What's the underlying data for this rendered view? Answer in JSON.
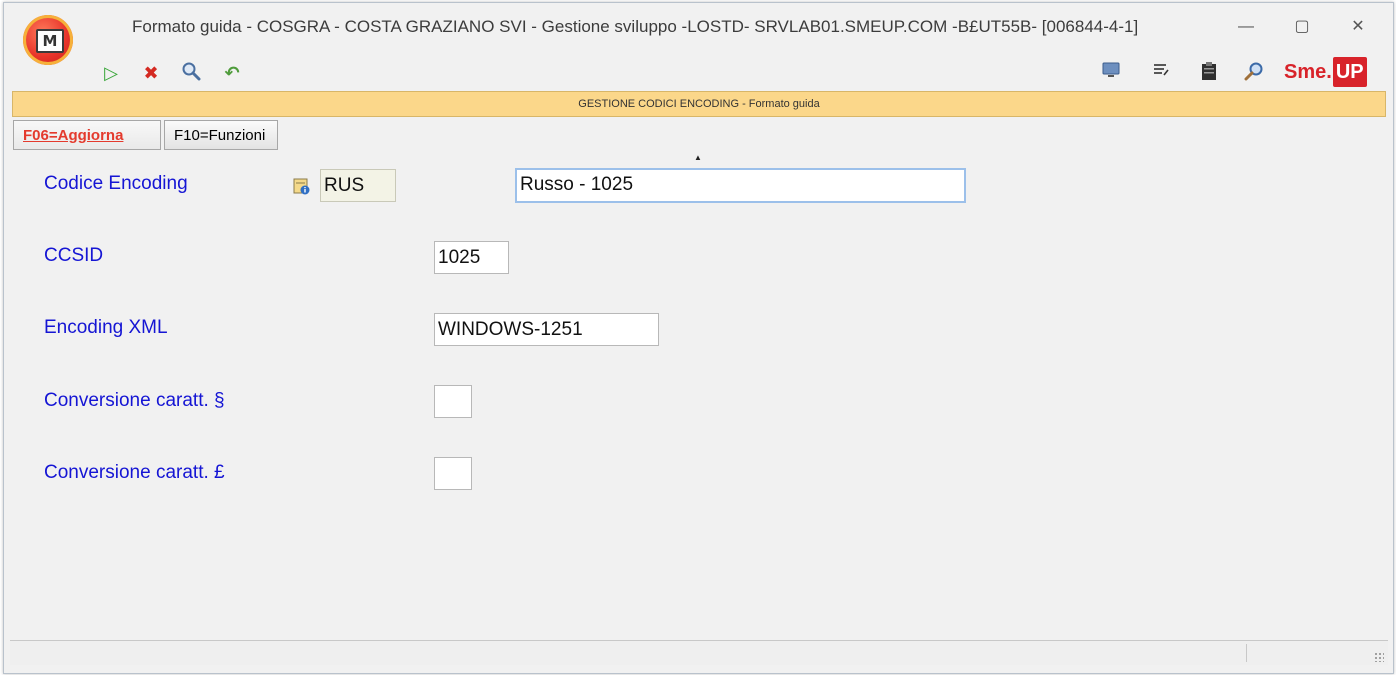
{
  "window": {
    "title": "Formato guida - COSGRA - COSTA GRAZIANO SVI - Gestione sviluppo -LOSTD- SRVLAB01.SMEUP.COM -B£UT55B- [006844-4-1]",
    "app_logo_letter": "M",
    "controls": {
      "minimize": "—",
      "maximize": "▢",
      "close": "✕"
    }
  },
  "toolbar": {
    "left_icons": [
      {
        "name": "run-icon",
        "glyph": "▷",
        "color": "#3aa63a"
      },
      {
        "name": "cancel-icon",
        "glyph": "✖",
        "color": "#d42a22"
      },
      {
        "name": "search-icon",
        "glyph": "🔍",
        "color": "#4a6fa0"
      },
      {
        "name": "back-icon",
        "glyph": "↶",
        "color": "#4f9c3b"
      }
    ],
    "right_icons": [
      {
        "name": "monitor-icon",
        "glyph": "🖥",
        "color": "#4a6fa0"
      },
      {
        "name": "notes-icon",
        "glyph": "≣",
        "color": "#444"
      },
      {
        "name": "clipboard-icon",
        "glyph": "📋",
        "color": "#333"
      },
      {
        "name": "magnifier-icon",
        "glyph": "🔎",
        "color": "#4a6fa0"
      }
    ],
    "brand": {
      "text": "Sme.",
      "highlight": "UP"
    }
  },
  "header": {
    "title": "GESTIONE CODICI ENCODING -  Formato guida"
  },
  "function_keys": [
    {
      "label": "F06=Aggiorna",
      "active": true
    },
    {
      "label": "F10=Funzioni",
      "active": false
    }
  ],
  "sort_indicator": "▲",
  "form": {
    "codice_encoding": {
      "label": "Codice Encoding",
      "code": "RUS",
      "description": "Russo - 1025"
    },
    "ccsid": {
      "label": "CCSID",
      "value": "1025"
    },
    "encoding_xml": {
      "label": "Encoding XML",
      "value": "WINDOWS-1251"
    },
    "conv_paragrafo": {
      "label": "Conversione caratt. §",
      "value": ""
    },
    "conv_sterlina": {
      "label": "Conversione caratt. £",
      "value": ""
    }
  },
  "colors": {
    "label_blue": "#1515d4",
    "header_band": "#fbd78a",
    "active_fkey": "#e43a2d",
    "brand_red": "#d8232a"
  }
}
